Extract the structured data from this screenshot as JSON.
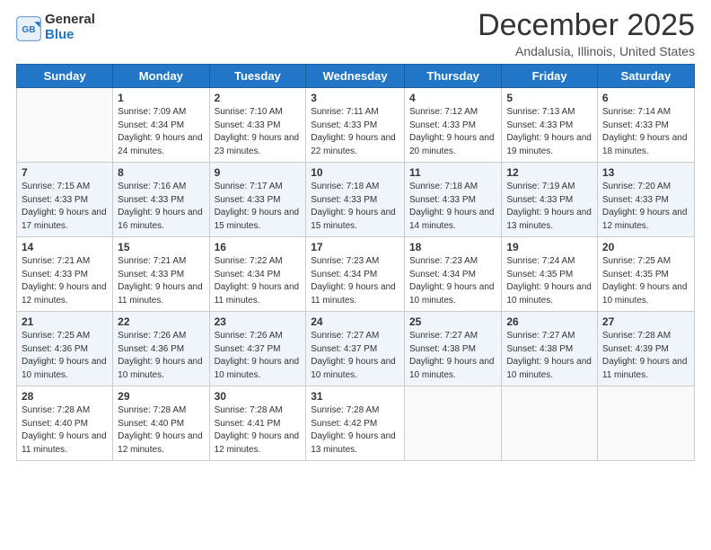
{
  "header": {
    "logo_general": "General",
    "logo_blue": "Blue",
    "month_title": "December 2025",
    "subtitle": "Andalusia, Illinois, United States"
  },
  "days_of_week": [
    "Sunday",
    "Monday",
    "Tuesday",
    "Wednesday",
    "Thursday",
    "Friday",
    "Saturday"
  ],
  "weeks": [
    [
      {
        "day": "",
        "sunrise": "",
        "sunset": "",
        "daylight": ""
      },
      {
        "day": "1",
        "sunrise": "Sunrise: 7:09 AM",
        "sunset": "Sunset: 4:34 PM",
        "daylight": "Daylight: 9 hours and 24 minutes."
      },
      {
        "day": "2",
        "sunrise": "Sunrise: 7:10 AM",
        "sunset": "Sunset: 4:33 PM",
        "daylight": "Daylight: 9 hours and 23 minutes."
      },
      {
        "day": "3",
        "sunrise": "Sunrise: 7:11 AM",
        "sunset": "Sunset: 4:33 PM",
        "daylight": "Daylight: 9 hours and 22 minutes."
      },
      {
        "day": "4",
        "sunrise": "Sunrise: 7:12 AM",
        "sunset": "Sunset: 4:33 PM",
        "daylight": "Daylight: 9 hours and 20 minutes."
      },
      {
        "day": "5",
        "sunrise": "Sunrise: 7:13 AM",
        "sunset": "Sunset: 4:33 PM",
        "daylight": "Daylight: 9 hours and 19 minutes."
      },
      {
        "day": "6",
        "sunrise": "Sunrise: 7:14 AM",
        "sunset": "Sunset: 4:33 PM",
        "daylight": "Daylight: 9 hours and 18 minutes."
      }
    ],
    [
      {
        "day": "7",
        "sunrise": "Sunrise: 7:15 AM",
        "sunset": "Sunset: 4:33 PM",
        "daylight": "Daylight: 9 hours and 17 minutes."
      },
      {
        "day": "8",
        "sunrise": "Sunrise: 7:16 AM",
        "sunset": "Sunset: 4:33 PM",
        "daylight": "Daylight: 9 hours and 16 minutes."
      },
      {
        "day": "9",
        "sunrise": "Sunrise: 7:17 AM",
        "sunset": "Sunset: 4:33 PM",
        "daylight": "Daylight: 9 hours and 15 minutes."
      },
      {
        "day": "10",
        "sunrise": "Sunrise: 7:18 AM",
        "sunset": "Sunset: 4:33 PM",
        "daylight": "Daylight: 9 hours and 15 minutes."
      },
      {
        "day": "11",
        "sunrise": "Sunrise: 7:18 AM",
        "sunset": "Sunset: 4:33 PM",
        "daylight": "Daylight: 9 hours and 14 minutes."
      },
      {
        "day": "12",
        "sunrise": "Sunrise: 7:19 AM",
        "sunset": "Sunset: 4:33 PM",
        "daylight": "Daylight: 9 hours and 13 minutes."
      },
      {
        "day": "13",
        "sunrise": "Sunrise: 7:20 AM",
        "sunset": "Sunset: 4:33 PM",
        "daylight": "Daylight: 9 hours and 12 minutes."
      }
    ],
    [
      {
        "day": "14",
        "sunrise": "Sunrise: 7:21 AM",
        "sunset": "Sunset: 4:33 PM",
        "daylight": "Daylight: 9 hours and 12 minutes."
      },
      {
        "day": "15",
        "sunrise": "Sunrise: 7:21 AM",
        "sunset": "Sunset: 4:33 PM",
        "daylight": "Daylight: 9 hours and 11 minutes."
      },
      {
        "day": "16",
        "sunrise": "Sunrise: 7:22 AM",
        "sunset": "Sunset: 4:34 PM",
        "daylight": "Daylight: 9 hours and 11 minutes."
      },
      {
        "day": "17",
        "sunrise": "Sunrise: 7:23 AM",
        "sunset": "Sunset: 4:34 PM",
        "daylight": "Daylight: 9 hours and 11 minutes."
      },
      {
        "day": "18",
        "sunrise": "Sunrise: 7:23 AM",
        "sunset": "Sunset: 4:34 PM",
        "daylight": "Daylight: 9 hours and 10 minutes."
      },
      {
        "day": "19",
        "sunrise": "Sunrise: 7:24 AM",
        "sunset": "Sunset: 4:35 PM",
        "daylight": "Daylight: 9 hours and 10 minutes."
      },
      {
        "day": "20",
        "sunrise": "Sunrise: 7:25 AM",
        "sunset": "Sunset: 4:35 PM",
        "daylight": "Daylight: 9 hours and 10 minutes."
      }
    ],
    [
      {
        "day": "21",
        "sunrise": "Sunrise: 7:25 AM",
        "sunset": "Sunset: 4:36 PM",
        "daylight": "Daylight: 9 hours and 10 minutes."
      },
      {
        "day": "22",
        "sunrise": "Sunrise: 7:26 AM",
        "sunset": "Sunset: 4:36 PM",
        "daylight": "Daylight: 9 hours and 10 minutes."
      },
      {
        "day": "23",
        "sunrise": "Sunrise: 7:26 AM",
        "sunset": "Sunset: 4:37 PM",
        "daylight": "Daylight: 9 hours and 10 minutes."
      },
      {
        "day": "24",
        "sunrise": "Sunrise: 7:27 AM",
        "sunset": "Sunset: 4:37 PM",
        "daylight": "Daylight: 9 hours and 10 minutes."
      },
      {
        "day": "25",
        "sunrise": "Sunrise: 7:27 AM",
        "sunset": "Sunset: 4:38 PM",
        "daylight": "Daylight: 9 hours and 10 minutes."
      },
      {
        "day": "26",
        "sunrise": "Sunrise: 7:27 AM",
        "sunset": "Sunset: 4:38 PM",
        "daylight": "Daylight: 9 hours and 10 minutes."
      },
      {
        "day": "27",
        "sunrise": "Sunrise: 7:28 AM",
        "sunset": "Sunset: 4:39 PM",
        "daylight": "Daylight: 9 hours and 11 minutes."
      }
    ],
    [
      {
        "day": "28",
        "sunrise": "Sunrise: 7:28 AM",
        "sunset": "Sunset: 4:40 PM",
        "daylight": "Daylight: 9 hours and 11 minutes."
      },
      {
        "day": "29",
        "sunrise": "Sunrise: 7:28 AM",
        "sunset": "Sunset: 4:40 PM",
        "daylight": "Daylight: 9 hours and 12 minutes."
      },
      {
        "day": "30",
        "sunrise": "Sunrise: 7:28 AM",
        "sunset": "Sunset: 4:41 PM",
        "daylight": "Daylight: 9 hours and 12 minutes."
      },
      {
        "day": "31",
        "sunrise": "Sunrise: 7:28 AM",
        "sunset": "Sunset: 4:42 PM",
        "daylight": "Daylight: 9 hours and 13 minutes."
      },
      {
        "day": "",
        "sunrise": "",
        "sunset": "",
        "daylight": ""
      },
      {
        "day": "",
        "sunrise": "",
        "sunset": "",
        "daylight": ""
      },
      {
        "day": "",
        "sunrise": "",
        "sunset": "",
        "daylight": ""
      }
    ]
  ]
}
